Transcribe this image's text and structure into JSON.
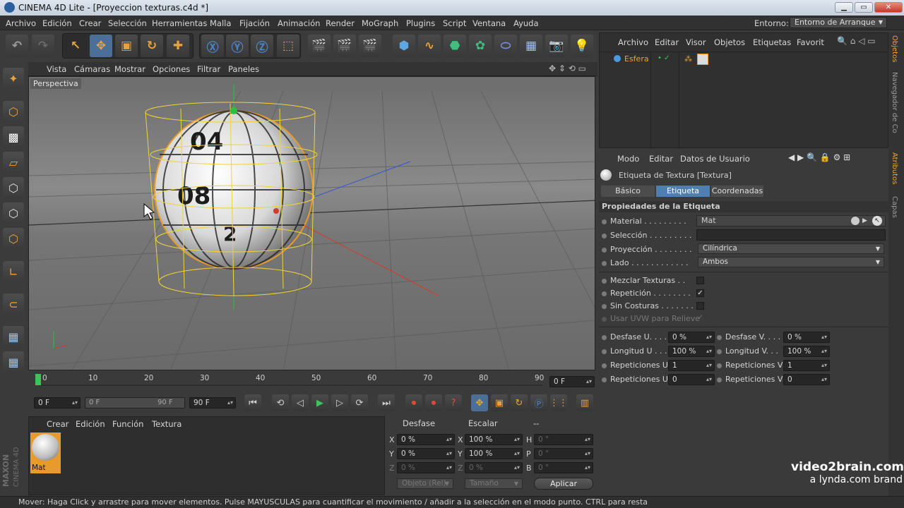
{
  "window": {
    "title": "CINEMA 4D Lite - [Proyeccion texturas.c4d *]",
    "minimize": "▁",
    "maximize": "▭",
    "close": "✕"
  },
  "menu": {
    "items": [
      "Archivo",
      "Edición",
      "Crear",
      "Selección",
      "Herramientas",
      "Malla",
      "Fijación",
      "Animación",
      "Render",
      "MoGraph",
      "Plugins",
      "Script",
      "Ventana",
      "Ayuda"
    ],
    "env_label": "Entorno:",
    "env_value": "Entorno de Arranque"
  },
  "viewport": {
    "menu": [
      "Vista",
      "Cámaras",
      "Mostrar",
      "Opciones",
      "Filtrar",
      "Paneles"
    ],
    "label": "Perspectiva",
    "texture_numbers": [
      "04",
      "08",
      "2"
    ]
  },
  "timeline": {
    "ticks": [
      "0",
      "10",
      "20",
      "30",
      "40",
      "50",
      "60",
      "70",
      "80",
      "90"
    ],
    "current": "0 F"
  },
  "transport": {
    "start": "0 F",
    "range_start": "0 F",
    "range_end": "90 F",
    "end": "90 F"
  },
  "materials": {
    "menu": [
      "Crear",
      "Edición",
      "Función",
      "Textura"
    ],
    "items": [
      {
        "name": "Mat"
      }
    ]
  },
  "coords": {
    "headers": [
      "Desfase",
      "Escalar",
      "--"
    ],
    "rows": [
      {
        "a": "X",
        "av": "0 %",
        "b": "X",
        "bv": "100 %",
        "c": "H",
        "cv": "0 °"
      },
      {
        "a": "Y",
        "av": "0 %",
        "b": "Y",
        "bv": "100 %",
        "c": "P",
        "cv": "0 °"
      },
      {
        "a": "Z",
        "av": "0 %",
        "b": "Z",
        "bv": "0 %",
        "c": "B",
        "cv": "0 °"
      }
    ],
    "mode": "Objeto (Rel)",
    "size": "Tamaño",
    "apply": "Aplicar"
  },
  "objects": {
    "menu": [
      "Archivo",
      "Editar",
      "Visor",
      "Objetos",
      "Etiquetas",
      "Favorit"
    ],
    "items": [
      {
        "name": "Esfera"
      }
    ]
  },
  "attributes": {
    "menu": [
      "Modo",
      "Editar",
      "Datos de Usuario"
    ],
    "header": "Etiqueta de Textura [Textura]",
    "tabs": [
      "Básico",
      "Etiqueta",
      "Coordenadas"
    ],
    "active_tab": "Etiqueta",
    "section": "Propiedades de la Etiqueta",
    "material_label": "Material . . . . . . . . .",
    "material_value": "Mat",
    "seleccion_label": "Selección . . . . . . . . .",
    "proyeccion_label": "Proyección . . . . . . . .",
    "proyeccion_value": "Cilíndrica",
    "lado_label": "Lado . . . . . . . . . . . .",
    "lado_value": "Ambos",
    "mezclar_label": "Mezclar Texturas . .",
    "repeticion_label": "Repetición . . . . . . . .",
    "sincosturas_label": "Sin Costuras . . . . . . . .",
    "uvw_label": "Usar UVW para Relieve",
    "params": [
      {
        "l1": "Desfase U. . . .",
        "v1": "0 %",
        "l2": "Desfase V. . . .",
        "v2": "0 %"
      },
      {
        "l1": "Longitud U . . .",
        "v1": "100 %",
        "l2": "Longitud V. . .",
        "v2": "100 %"
      },
      {
        "l1": "Repeticiones U",
        "v1": "1",
        "l2": "Repeticiones V",
        "v2": "1"
      },
      {
        "l1": "Repeticiones U",
        "v1": "0",
        "l2": "Repeticiones V",
        "v2": "0"
      }
    ]
  },
  "right_tabs": [
    "Objetos",
    "Navegador de Co",
    "Atributos",
    "Capas"
  ],
  "status": "Mover: Haga Click y arrastre para mover elementos. Pulse MAYUSCULAS para cuantificar el movimiento / añadir a la selección en el modo punto. CTRL para resta",
  "brand": {
    "line1": "video2brain.com",
    "line2": "a lynda.com brand",
    "maxon": "MAXON",
    "cinema": "CINEMA 4D"
  }
}
